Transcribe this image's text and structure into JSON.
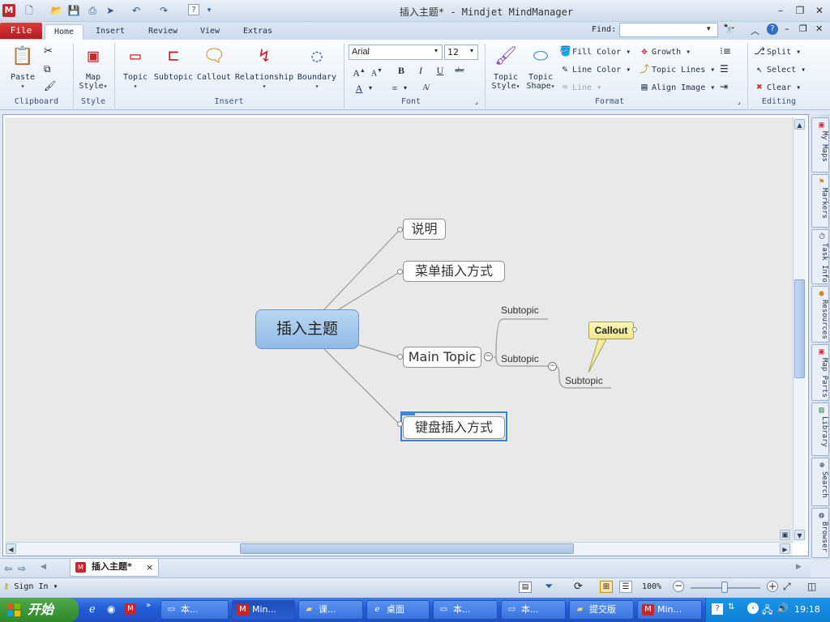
{
  "window": {
    "title": "插入主题* - Mindjet MindManager",
    "app_icon": "M",
    "controls": [
      "minimize-icon",
      "restore-icon",
      "close-icon"
    ]
  },
  "ribbon": {
    "file_tab": "File",
    "tabs": [
      {
        "label": "Home",
        "active": true
      },
      {
        "label": "Insert"
      },
      {
        "label": "Review"
      },
      {
        "label": "View"
      },
      {
        "label": "Extras"
      }
    ],
    "find_label": "Find:",
    "find_value": "",
    "groups": {
      "clipboard": {
        "label": "Clipboard",
        "paste": "Paste"
      },
      "style": {
        "label": "Style",
        "map_style_line1": "Map",
        "map_style_line2": "Style"
      },
      "insert": {
        "label": "Insert",
        "topic": "Topic",
        "subtopic": "Subtopic",
        "callout": "Callout",
        "relationship": "Relationship",
        "boundary": "Boundary"
      },
      "font": {
        "label": "Font",
        "font_name": "Arial",
        "font_size": "12",
        "bold": "B",
        "italic": "I",
        "underline": "U",
        "strike": "abc"
      },
      "format": {
        "label": "Format",
        "topic_style_line1": "Topic",
        "topic_style_line2": "Style",
        "topic_shape_line1": "Topic",
        "topic_shape_line2": "Shape",
        "fill_color": "Fill Color",
        "line_color": "Line Color",
        "line": "Line",
        "growth": "Growth",
        "topic_lines": "Topic Lines",
        "align_image": "Align Image"
      },
      "editing": {
        "label": "Editing",
        "split": "Split",
        "select": "Select",
        "clear": "Clear"
      }
    }
  },
  "mindmap": {
    "central": "插入主题",
    "main_topics": [
      "说明",
      "菜单插入方式",
      "Main Topic",
      "键盘插入方式"
    ],
    "subtopics": [
      "Subtopic",
      "Subtopic",
      "Subtopic"
    ],
    "callout": "Callout",
    "collapse_symbol": "−"
  },
  "side_tabs": [
    "My Maps",
    "Markers",
    "Task Info",
    "Resources",
    "Map Parts",
    "Library",
    "Search",
    "Browser"
  ],
  "doc_tab": {
    "label": "插入主题*",
    "close": "×"
  },
  "status": {
    "sign_in": "Sign In",
    "zoom": "100%"
  },
  "taskbar": {
    "start": "开始",
    "buttons": [
      {
        "label": "本...",
        "active": false
      },
      {
        "label": "Min...",
        "active": true
      },
      {
        "label": "课...",
        "active": false
      },
      {
        "label": "桌面",
        "active": false
      },
      {
        "label": "本...",
        "active": false
      },
      {
        "label": "本...",
        "active": false
      },
      {
        "label": "提交版",
        "active": false
      },
      {
        "label": "Min...",
        "active": false
      }
    ],
    "clock": "19:18"
  },
  "colors": {
    "file_tab": "#c8242b",
    "central_fill": "#a7c9ee",
    "callout_fill": "#f5ef9f",
    "selection": "#3a86d6",
    "taskbar": "#245edb"
  }
}
